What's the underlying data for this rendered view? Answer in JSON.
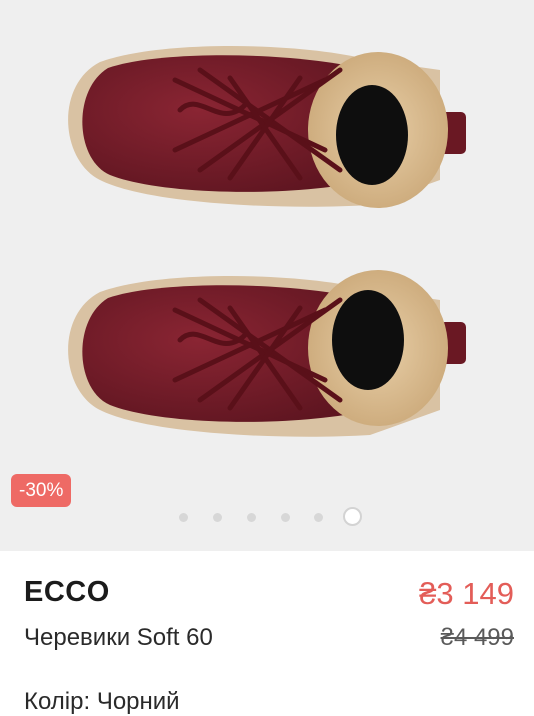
{
  "gallery": {
    "badge": "-30%",
    "dots_count": 6,
    "active_dot_index": 5
  },
  "product": {
    "brand": "ECCO",
    "name": "Черевики Soft 60",
    "price_current": "₴3 149",
    "price_old": "₴4 499",
    "next_line": "Колір: Чорний"
  },
  "colors": {
    "gallery_bg": "#efefef",
    "badge_bg": "#ee6a65",
    "price_current": "#e35d58",
    "shoe_leather": "#7a1e2a",
    "sole": "#d8bf9f",
    "fur": "#d9b98e"
  }
}
